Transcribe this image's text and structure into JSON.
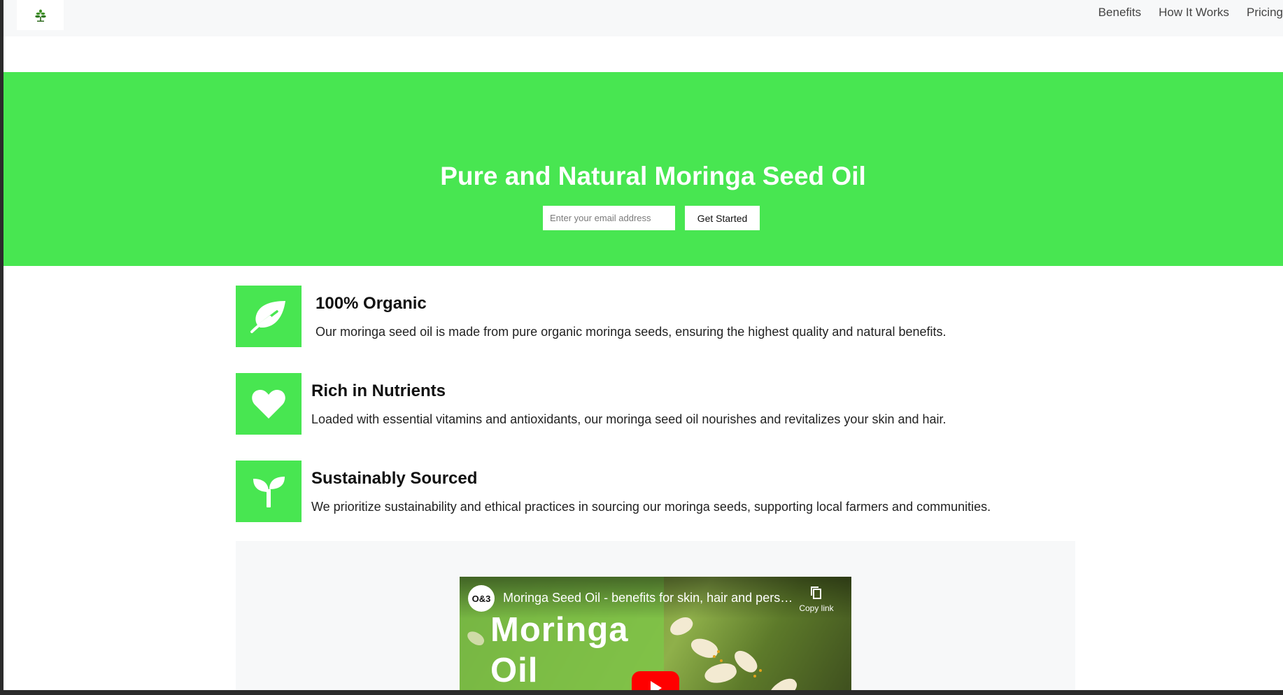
{
  "nav": {
    "logo_icon": "moringa-plant-icon",
    "links": [
      "Benefits",
      "How It Works",
      "Pricing"
    ]
  },
  "hero": {
    "title": "Pure and Natural Moringa Seed Oil",
    "email_placeholder": "Enter your email address",
    "cta_label": "Get Started",
    "background_color": "#48e651"
  },
  "features": [
    {
      "icon": "leaf-icon",
      "title": "100% Organic",
      "description": "Our moringa seed oil is made from pure organic moringa seeds, ensuring the highest quality and natural benefits."
    },
    {
      "icon": "heart-icon",
      "title": "Rich in Nutrients",
      "description": "Loaded with essential vitamins and antioxidants, our moringa seed oil nourishes and revitalizes your skin and hair."
    },
    {
      "icon": "seedling-icon",
      "title": "Sustainably Sourced",
      "description": "We prioritize sustainability and ethical practices in sourcing our moringa seeds, supporting local farmers and communities."
    }
  ],
  "video": {
    "channel_badge": "O&3",
    "title": "Moringa Seed Oil - benefits for skin, hair and pers…",
    "copy_link_label": "Copy link",
    "thumbnail_text_line1": "Moringa",
    "thumbnail_text_line2": "Oil"
  },
  "colors": {
    "accent": "#48e651",
    "nav_background": "#f7f8f9",
    "youtube_red": "#ff0000"
  }
}
